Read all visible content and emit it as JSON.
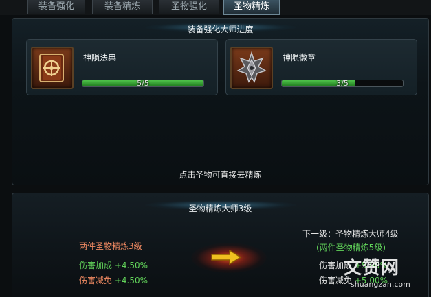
{
  "tabs": [
    {
      "label": "装备强化",
      "active": false
    },
    {
      "label": "装备精炼",
      "active": false
    },
    {
      "label": "圣物强化",
      "active": false
    },
    {
      "label": "圣物精炼",
      "active": true
    }
  ],
  "top_panel": {
    "title": "装备强化大师进度",
    "items": [
      {
        "name": "神陨法典",
        "icon": "tome-icon",
        "progress_text": "5/5",
        "progress": 1.0
      },
      {
        "name": "神陨徽章",
        "icon": "emblem-icon",
        "progress_text": "3/5",
        "progress": 0.6
      }
    ],
    "hint": "点击圣物可直接去精炼"
  },
  "bottom_panel": {
    "title": "圣物精炼大师3级",
    "current": {
      "requirement": "两件圣物精炼3级",
      "stat1_label": "伤害加成",
      "stat1_value": "+4.50%",
      "stat2_label": "伤害减免",
      "stat2_value": "+4.50%"
    },
    "next": {
      "header": "下一级：圣物精炼大师4级",
      "requirement": "(两件圣物精炼5级)",
      "stat1_label": "伤害加成",
      "stat1_value": "+5.00%",
      "stat2_label": "伤害减免",
      "stat2_value": "+5.00%"
    }
  },
  "watermark": {
    "main": "文赞网",
    "url": "shuangzan.com"
  },
  "colors": {
    "orange_text": "#f08a62",
    "green_text": "#62d45a",
    "progress_green": "#4fc24a",
    "active_tab": "#3b5361"
  }
}
